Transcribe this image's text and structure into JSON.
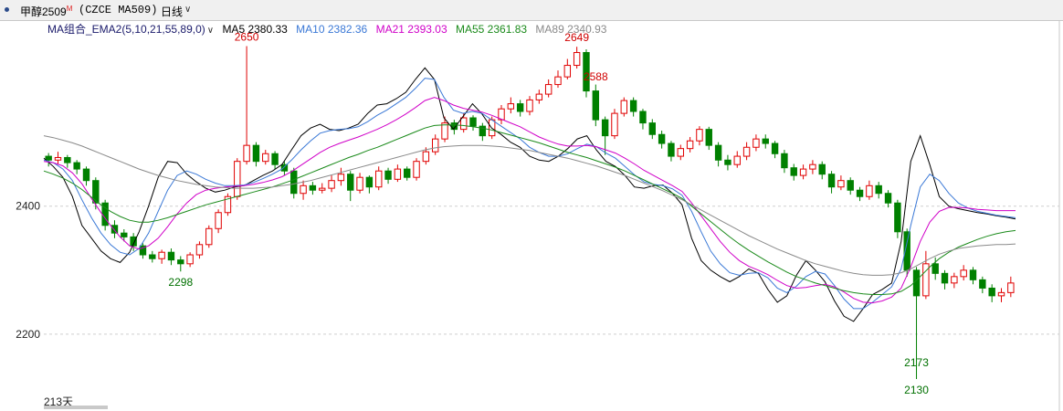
{
  "header": {
    "symbol": "甲醇2509",
    "superscript": "M",
    "code": "(CZCE MA509)",
    "period": "日线"
  },
  "indicator": {
    "name": "MA组合_EMA2(5,10,21,55,89,0)",
    "items": [
      {
        "label": "MA5 2380.33",
        "color": "#000000"
      },
      {
        "label": "MA10 2382.36",
        "color": "#3a78d6"
      },
      {
        "label": "MA21 2393.03",
        "color": "#d000c8"
      },
      {
        "label": "MA55 2361.83",
        "color": "#1a8a1a"
      },
      {
        "label": "MA89 2340.93",
        "color": "#8a8a8a"
      }
    ]
  },
  "footer": {
    "day_count": "213天"
  },
  "chart_data": {
    "type": "candlestick",
    "yaxis_ticks": [
      2400,
      2200
    ],
    "ylim": [
      2120,
      2665
    ],
    "up_color": "#e00000",
    "down_color": "#008000",
    "annotations": [
      {
        "label": "2650",
        "value": 2650,
        "kind": "high"
      },
      {
        "label": "2649",
        "value": 2649,
        "kind": "high"
      },
      {
        "label": "2588",
        "value": 2588,
        "kind": "high"
      },
      {
        "label": "2298",
        "value": 2298,
        "kind": "low"
      },
      {
        "label": "2130",
        "value": 2130,
        "kind": "low"
      },
      {
        "label": "2173",
        "value": 2173,
        "kind": "low"
      }
    ],
    "ma_series": [
      {
        "name": "MA5",
        "color": "#000000",
        "values": [
          2475,
          2462,
          2445,
          2415,
          2370,
          2350,
          2330,
          2318,
          2312,
          2328,
          2360,
          2400,
          2445,
          2470,
          2468,
          2450,
          2438,
          2428,
          2422,
          2425,
          2430,
          2432,
          2440,
          2448,
          2455,
          2465,
          2488,
          2510,
          2522,
          2528,
          2520,
          2518,
          2522,
          2528,
          2545,
          2558,
          2560,
          2568,
          2578,
          2598,
          2616,
          2598,
          2538,
          2520,
          2540,
          2560,
          2544,
          2522,
          2512,
          2500,
          2492,
          2478,
          2472,
          2470,
          2478,
          2490,
          2505,
          2510,
          2488,
          2470,
          2462,
          2448,
          2430,
          2428,
          2432,
          2433,
          2420,
          2402,
          2350,
          2315,
          2300,
          2290,
          2282,
          2290,
          2302,
          2295,
          2270,
          2250,
          2260,
          2292,
          2315,
          2300,
          2282,
          2252,
          2228,
          2220,
          2240,
          2262,
          2270,
          2280,
          2345,
          2470,
          2510,
          2465,
          2415,
          2400,
          2396,
          2393,
          2390,
          2388,
          2385,
          2383,
          2380
        ]
      },
      {
        "name": "MA10",
        "color": "#3a78d6",
        "values": [
          2472,
          2468,
          2458,
          2440,
          2410,
          2382,
          2358,
          2340,
          2328,
          2324,
          2334,
          2358,
          2392,
          2425,
          2448,
          2455,
          2450,
          2442,
          2436,
          2432,
          2432,
          2433,
          2437,
          2443,
          2450,
          2458,
          2472,
          2488,
          2502,
          2514,
          2518,
          2520,
          2521,
          2524,
          2532,
          2542,
          2550,
          2560,
          2570,
          2584,
          2600,
          2598,
          2570,
          2550,
          2545,
          2548,
          2545,
          2535,
          2525,
          2515,
          2505,
          2492,
          2484,
          2478,
          2478,
          2482,
          2490,
          2497,
          2493,
          2483,
          2475,
          2462,
          2449,
          2438,
          2434,
          2432,
          2427,
          2417,
          2392,
          2360,
          2330,
          2310,
          2296,
          2292,
          2295,
          2296,
          2288,
          2272,
          2265,
          2275,
          2290,
          2298,
          2294,
          2276,
          2255,
          2240,
          2240,
          2250,
          2262,
          2274,
          2302,
          2370,
          2430,
          2450,
          2440,
          2420,
          2405,
          2397,
          2392,
          2389,
          2386,
          2384,
          2382
        ]
      },
      {
        "name": "MA21",
        "color": "#d000c8",
        "values": [
          2470,
          2468,
          2463,
          2452,
          2435,
          2412,
          2390,
          2370,
          2352,
          2338,
          2333,
          2338,
          2350,
          2368,
          2388,
          2405,
          2418,
          2425,
          2428,
          2430,
          2431,
          2432,
          2434,
          2437,
          2441,
          2446,
          2454,
          2464,
          2474,
          2484,
          2492,
          2498,
          2503,
          2508,
          2514,
          2520,
          2527,
          2535,
          2544,
          2554,
          2565,
          2570,
          2565,
          2558,
          2553,
          2550,
          2547,
          2542,
          2536,
          2530,
          2524,
          2516,
          2508,
          2502,
          2497,
          2494,
          2494,
          2495,
          2493,
          2488,
          2483,
          2475,
          2466,
          2456,
          2448,
          2440,
          2432,
          2423,
          2405,
          2385,
          2365,
          2345,
          2328,
          2315,
          2306,
          2300,
          2293,
          2284,
          2276,
          2272,
          2273,
          2276,
          2278,
          2274,
          2266,
          2256,
          2250,
          2249,
          2252,
          2258,
          2272,
          2305,
          2345,
          2375,
          2392,
          2398,
          2398,
          2397,
          2395,
          2394,
          2393,
          2393,
          2393
        ]
      },
      {
        "name": "MA55",
        "color": "#1a8a1a",
        "values": [
          2455,
          2450,
          2444,
          2436,
          2426,
          2414,
          2402,
          2392,
          2384,
          2378,
          2375,
          2375,
          2378,
          2382,
          2387,
          2392,
          2397,
          2402,
          2406,
          2410,
          2414,
          2418,
          2422,
          2426,
          2430,
          2435,
          2440,
          2446,
          2452,
          2458,
          2464,
          2470,
          2476,
          2481,
          2487,
          2492,
          2498,
          2504,
          2510,
          2516,
          2522,
          2526,
          2527,
          2527,
          2526,
          2524,
          2522,
          2519,
          2515,
          2511,
          2507,
          2503,
          2499,
          2494,
          2489,
          2484,
          2480,
          2476,
          2471,
          2466,
          2461,
          2455,
          2448,
          2441,
          2434,
          2427,
          2420,
          2412,
          2400,
          2388,
          2376,
          2364,
          2352,
          2341,
          2331,
          2322,
          2313,
          2305,
          2297,
          2290,
          2285,
          2280,
          2276,
          2272,
          2268,
          2265,
          2263,
          2262,
          2262,
          2263,
          2267,
          2276,
          2290,
          2305,
          2318,
          2328,
          2336,
          2342,
          2348,
          2353,
          2357,
          2360,
          2362
        ]
      },
      {
        "name": "MA89",
        "color": "#8a8a8a",
        "values": [
          2510,
          2507,
          2503,
          2499,
          2494,
          2488,
          2482,
          2476,
          2470,
          2464,
          2458,
          2453,
          2448,
          2444,
          2440,
          2437,
          2434,
          2432,
          2430,
          2429,
          2428,
          2428,
          2428,
          2429,
          2430,
          2432,
          2434,
          2437,
          2440,
          2444,
          2448,
          2452,
          2456,
          2460,
          2464,
          2468,
          2472,
          2476,
          2480,
          2484,
          2488,
          2491,
          2493,
          2494,
          2495,
          2495,
          2495,
          2494,
          2493,
          2491,
          2489,
          2487,
          2484,
          2481,
          2478,
          2475,
          2471,
          2467,
          2463,
          2458,
          2453,
          2448,
          2442,
          2436,
          2430,
          2424,
          2417,
          2410,
          2402,
          2394,
          2386,
          2378,
          2370,
          2362,
          2354,
          2347,
          2340,
          2333,
          2327,
          2321,
          2315,
          2310,
          2306,
          2302,
          2298,
          2295,
          2293,
          2292,
          2292,
          2293,
          2296,
          2302,
          2310,
          2318,
          2325,
          2330,
          2334,
          2336,
          2338,
          2339,
          2340,
          2340,
          2341
        ]
      }
    ],
    "candles": [
      [
        2478,
        2472,
        2483,
        2462
      ],
      [
        2472,
        2476,
        2485,
        2466
      ],
      [
        2476,
        2468,
        2480,
        2460
      ],
      [
        2468,
        2458,
        2472,
        2450
      ],
      [
        2458,
        2440,
        2462,
        2432
      ],
      [
        2440,
        2405,
        2445,
        2395
      ],
      [
        2405,
        2370,
        2410,
        2362
      ],
      [
        2370,
        2358,
        2378,
        2350
      ],
      [
        2358,
        2352,
        2364,
        2345
      ],
      [
        2352,
        2338,
        2358,
        2330
      ],
      [
        2338,
        2324,
        2342,
        2318
      ],
      [
        2324,
        2318,
        2330,
        2312
      ],
      [
        2318,
        2328,
        2332,
        2310
      ],
      [
        2328,
        2316,
        2334,
        2308
      ],
      [
        2316,
        2310,
        2322,
        2298
      ],
      [
        2310,
        2324,
        2328,
        2305
      ],
      [
        2324,
        2340,
        2345,
        2318
      ],
      [
        2340,
        2365,
        2370,
        2335
      ],
      [
        2365,
        2390,
        2395,
        2358
      ],
      [
        2390,
        2415,
        2420,
        2385
      ],
      [
        2415,
        2470,
        2475,
        2410
      ],
      [
        2470,
        2495,
        2650,
        2465
      ],
      [
        2495,
        2470,
        2500,
        2462
      ],
      [
        2470,
        2482,
        2488,
        2465
      ],
      [
        2482,
        2465,
        2486,
        2458
      ],
      [
        2465,
        2455,
        2470,
        2448
      ],
      [
        2455,
        2420,
        2460,
        2412
      ],
      [
        2420,
        2432,
        2440,
        2410
      ],
      [
        2432,
        2425,
        2438,
        2418
      ],
      [
        2425,
        2428,
        2436,
        2420
      ],
      [
        2428,
        2440,
        2448,
        2422
      ],
      [
        2440,
        2450,
        2460,
        2432
      ],
      [
        2450,
        2425,
        2455,
        2408
      ],
      [
        2425,
        2445,
        2452,
        2420
      ],
      [
        2445,
        2430,
        2448,
        2420
      ],
      [
        2430,
        2455,
        2462,
        2425
      ],
      [
        2455,
        2442,
        2460,
        2435
      ],
      [
        2442,
        2458,
        2465,
        2438
      ],
      [
        2458,
        2445,
        2462,
        2440
      ],
      [
        2445,
        2470,
        2475,
        2440
      ],
      [
        2470,
        2485,
        2492,
        2465
      ],
      [
        2485,
        2505,
        2512,
        2480
      ],
      [
        2505,
        2530,
        2540,
        2500
      ],
      [
        2530,
        2520,
        2535,
        2512
      ],
      [
        2520,
        2538,
        2545,
        2515
      ],
      [
        2538,
        2525,
        2542,
        2518
      ],
      [
        2525,
        2510,
        2530,
        2502
      ],
      [
        2510,
        2535,
        2540,
        2505
      ],
      [
        2535,
        2552,
        2558,
        2528
      ],
      [
        2552,
        2560,
        2570,
        2545
      ],
      [
        2560,
        2548,
        2566,
        2540
      ],
      [
        2548,
        2566,
        2572,
        2542
      ],
      [
        2566,
        2575,
        2582,
        2560
      ],
      [
        2575,
        2590,
        2598,
        2570
      ],
      [
        2590,
        2602,
        2612,
        2585
      ],
      [
        2602,
        2620,
        2630,
        2598
      ],
      [
        2620,
        2640,
        2649,
        2615
      ],
      [
        2640,
        2580,
        2645,
        2570
      ],
      [
        2580,
        2535,
        2590,
        2525
      ],
      [
        2535,
        2510,
        2540,
        2480
      ],
      [
        2510,
        2545,
        2552,
        2505
      ],
      [
        2545,
        2565,
        2570,
        2540
      ],
      [
        2565,
        2548,
        2570,
        2540
      ],
      [
        2548,
        2530,
        2552,
        2520
      ],
      [
        2530,
        2512,
        2536,
        2505
      ],
      [
        2512,
        2498,
        2518,
        2490
      ],
      [
        2498,
        2478,
        2502,
        2470
      ],
      [
        2478,
        2490,
        2496,
        2472
      ],
      [
        2490,
        2502,
        2508,
        2484
      ],
      [
        2502,
        2520,
        2525,
        2495
      ],
      [
        2520,
        2495,
        2524,
        2488
      ],
      [
        2495,
        2472,
        2500,
        2462
      ],
      [
        2472,
        2465,
        2480,
        2456
      ],
      [
        2465,
        2478,
        2486,
        2460
      ],
      [
        2478,
        2492,
        2500,
        2472
      ],
      [
        2492,
        2505,
        2512,
        2486
      ],
      [
        2505,
        2498,
        2512,
        2490
      ],
      [
        2498,
        2482,
        2502,
        2475
      ],
      [
        2482,
        2460,
        2488,
        2452
      ],
      [
        2460,
        2448,
        2466,
        2440
      ],
      [
        2448,
        2458,
        2465,
        2442
      ],
      [
        2458,
        2465,
        2472,
        2450
      ],
      [
        2465,
        2450,
        2470,
        2442
      ],
      [
        2450,
        2430,
        2455,
        2420
      ],
      [
        2430,
        2440,
        2448,
        2425
      ],
      [
        2440,
        2425,
        2445,
        2418
      ],
      [
        2425,
        2415,
        2430,
        2408
      ],
      [
        2415,
        2432,
        2440,
        2410
      ],
      [
        2432,
        2420,
        2438,
        2412
      ],
      [
        2420,
        2405,
        2425,
        2398
      ],
      [
        2405,
        2360,
        2410,
        2350
      ],
      [
        2360,
        2300,
        2365,
        2290
      ],
      [
        2300,
        2260,
        2305,
        2130
      ],
      [
        2260,
        2310,
        2330,
        2255
      ],
      [
        2310,
        2295,
        2320,
        2285
      ],
      [
        2295,
        2280,
        2300,
        2270
      ],
      [
        2280,
        2290,
        2296,
        2272
      ],
      [
        2290,
        2300,
        2308,
        2284
      ],
      [
        2300,
        2285,
        2305,
        2278
      ],
      [
        2285,
        2272,
        2290,
        2264
      ],
      [
        2272,
        2260,
        2278,
        2250
      ],
      [
        2260,
        2265,
        2272,
        2250
      ],
      [
        2265,
        2280,
        2290,
        2258
      ]
    ]
  }
}
